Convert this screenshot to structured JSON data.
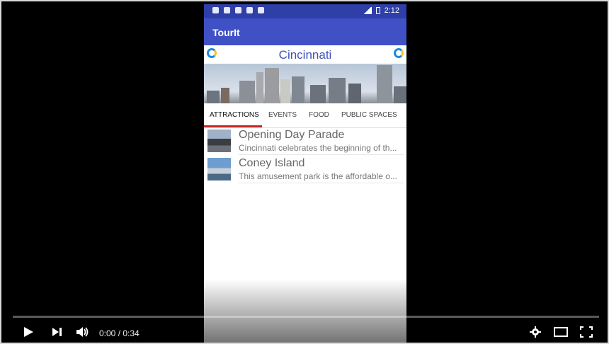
{
  "phone": {
    "app_title": "TourIt",
    "status_time": "2:12",
    "city": "Cincinnati",
    "tabs": [
      "ATTRACTIONS",
      "EVENTS",
      "FOOD",
      "PUBLIC SPACES"
    ],
    "active_tab": "ATTRACTIONS",
    "items": [
      {
        "title": "Opening Day Parade",
        "desc": "Cincinnati celebrates the beginning of th..."
      },
      {
        "title": "Coney Island",
        "desc": "This amusement park is the affordable o..."
      }
    ]
  },
  "player": {
    "time_display": "0:00 / 0:34",
    "progress_percent": 0,
    "icons": [
      "play-icon",
      "next-icon",
      "volume-icon",
      "settings-icon",
      "theater-mode-icon",
      "fullscreen-icon"
    ]
  }
}
